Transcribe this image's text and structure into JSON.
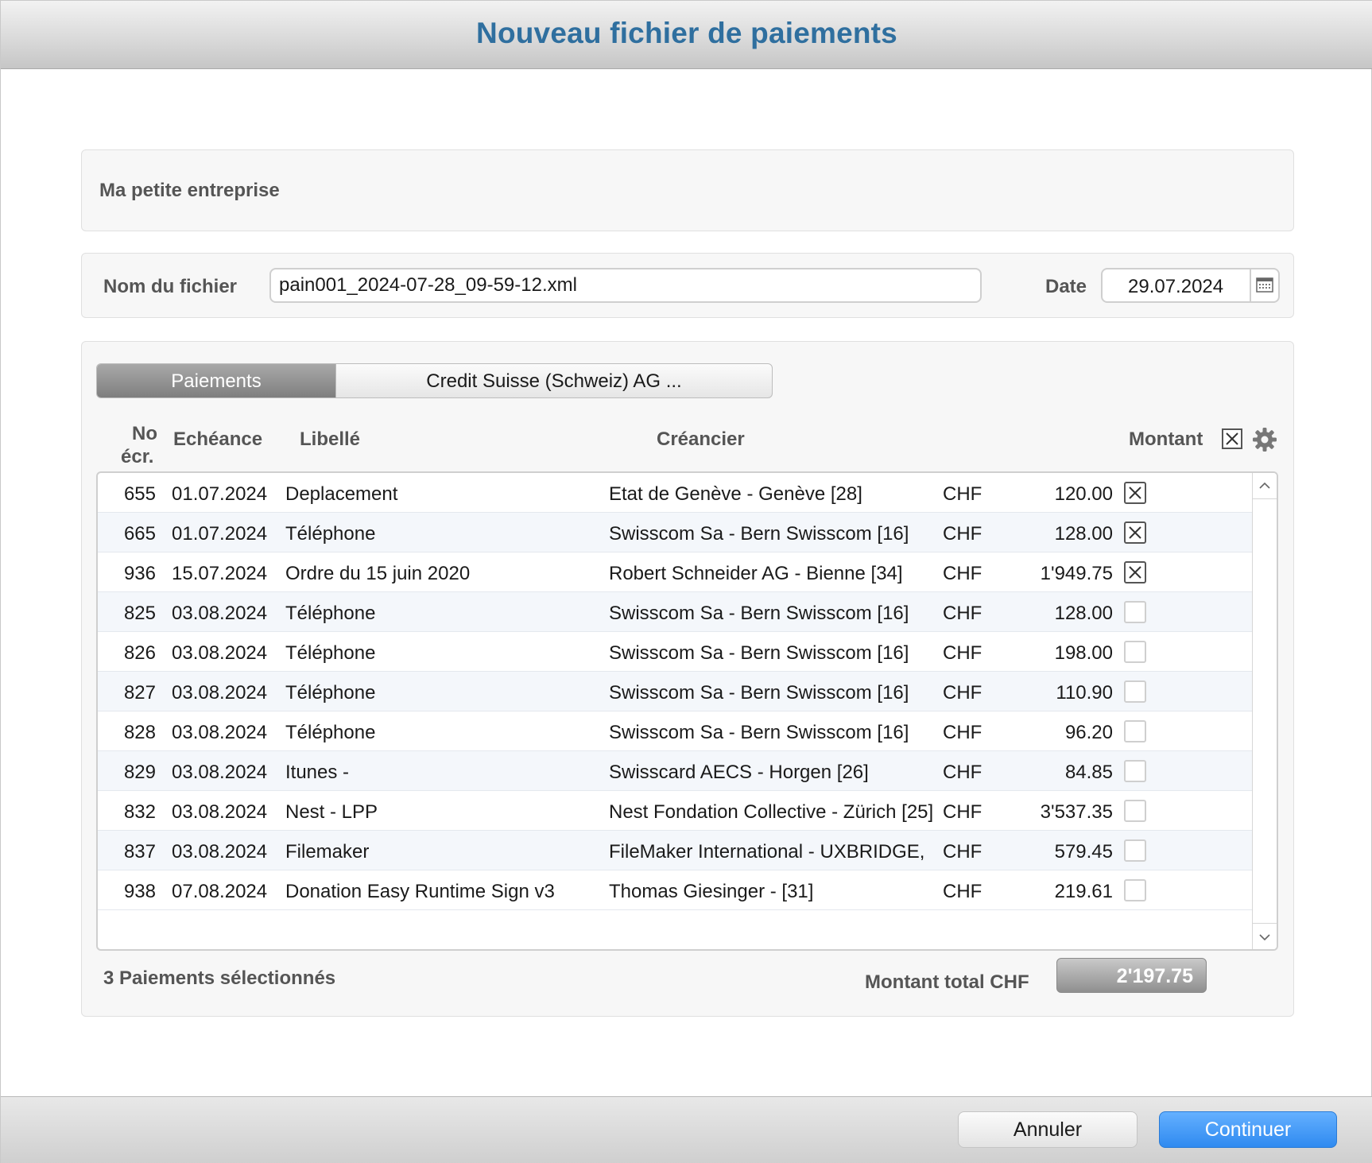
{
  "window": {
    "title": "Nouveau fichier de paiements"
  },
  "company": {
    "name": "Ma petite entreprise"
  },
  "file": {
    "name_label": "Nom du fichier",
    "name_value": "pain001_2024-07-28_09-59-12.xml",
    "date_label": "Date",
    "date_value": "29.07.2024"
  },
  "tabs": [
    {
      "label": "Paiements",
      "active": true
    },
    {
      "label": "Credit Suisse (Schweiz) AG ...",
      "active": false
    }
  ],
  "table": {
    "headers": {
      "no_line1": "No",
      "no_line2": "écr.",
      "echeance": "Echéance",
      "libelle": "Libellé",
      "creancier": "Créancier",
      "montant": "Montant"
    },
    "rows": [
      {
        "no": "655",
        "echeance": "01.07.2024",
        "libelle": "Deplacement",
        "creancier": "Etat de Genève - Genève  [28]",
        "currency": "CHF",
        "amount": "120.00",
        "selected": true
      },
      {
        "no": "665",
        "echeance": "01.07.2024",
        "libelle": "Téléphone",
        "creancier": "Swisscom Sa - Bern Swisscom [16]",
        "currency": "CHF",
        "amount": "128.00",
        "selected": true
      },
      {
        "no": "936",
        "echeance": "15.07.2024",
        "libelle": "Ordre du 15 juin 2020",
        "creancier": "Robert Schneider AG - Bienne [34]",
        "currency": "CHF",
        "amount": "1'949.75",
        "selected": true
      },
      {
        "no": "825",
        "echeance": "03.08.2024",
        "libelle": "Téléphone",
        "creancier": "Swisscom Sa - Bern Swisscom [16]",
        "currency": "CHF",
        "amount": "128.00",
        "selected": false
      },
      {
        "no": "826",
        "echeance": "03.08.2024",
        "libelle": "Téléphone",
        "creancier": "Swisscom Sa - Bern Swisscom [16]",
        "currency": "CHF",
        "amount": "198.00",
        "selected": false
      },
      {
        "no": "827",
        "echeance": "03.08.2024",
        "libelle": "Téléphone",
        "creancier": "Swisscom Sa - Bern Swisscom [16]",
        "currency": "CHF",
        "amount": "110.90",
        "selected": false
      },
      {
        "no": "828",
        "echeance": "03.08.2024",
        "libelle": "Téléphone",
        "creancier": "Swisscom Sa - Bern Swisscom [16]",
        "currency": "CHF",
        "amount": "96.20",
        "selected": false
      },
      {
        "no": "829",
        "echeance": "03.08.2024",
        "libelle": "Itunes -",
        "creancier": "Swisscard AECS - Horgen [26]",
        "currency": "CHF",
        "amount": "84.85",
        "selected": false
      },
      {
        "no": "832",
        "echeance": "03.08.2024",
        "libelle": "Nest - LPP",
        "creancier": "Nest Fondation Collective - Zürich [25]",
        "currency": "CHF",
        "amount": "3'537.35",
        "selected": false
      },
      {
        "no": "837",
        "echeance": "03.08.2024",
        "libelle": "Filemaker",
        "creancier": "FileMaker International - UXBRIDGE,",
        "currency": "CHF",
        "amount": "579.45",
        "selected": false
      },
      {
        "no": "938",
        "echeance": "07.08.2024",
        "libelle": "Donation Easy Runtime Sign v3",
        "creancier": "Thomas Giesinger -  [31]",
        "currency": "CHF",
        "amount": "219.61",
        "selected": false
      }
    ]
  },
  "summary": {
    "selected_text": "3 Paiements sélectionnés",
    "total_label": "Montant total CHF",
    "total_value": "2'197.75"
  },
  "buttons": {
    "cancel": "Annuler",
    "continue": "Continuer"
  },
  "icons": {
    "calendar": "calendar-icon",
    "select_all": "checkbox-checked-icon",
    "settings": "gear-icon",
    "scroll_up": "chevron-up-icon",
    "scroll_down": "chevron-down-icon"
  },
  "colors": {
    "title": "#2f6f9f",
    "accent": "#2f8af0",
    "tab_active": "#8a8a8a",
    "row_alt": "#f4f7fb"
  }
}
